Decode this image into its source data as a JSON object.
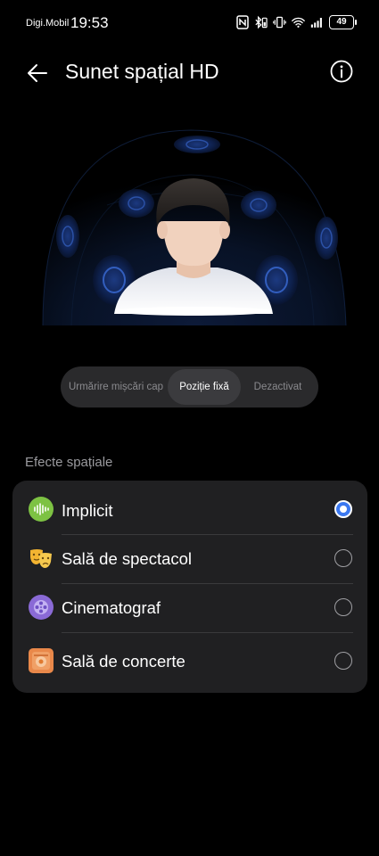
{
  "status": {
    "carrier": "Digi.Mobil",
    "time": "19:53",
    "battery": "49"
  },
  "header": {
    "title": "Sunet spațial HD"
  },
  "modes": {
    "items": [
      {
        "label": "Urmărire mișcări cap",
        "selected": false
      },
      {
        "label": "Poziție fixă",
        "selected": true
      },
      {
        "label": "Dezactivat",
        "selected": false
      }
    ]
  },
  "effects": {
    "section_title": "Efecte spațiale",
    "items": [
      {
        "label": "Implicit",
        "icon": "soundwave-icon",
        "color": "#7dc243",
        "selected": true
      },
      {
        "label": "Sală de spectacol",
        "icon": "theater-masks-icon",
        "color": "#f1b33a",
        "selected": false
      },
      {
        "label": "Cinematograf",
        "icon": "film-reel-icon",
        "color": "#8a6ad6",
        "selected": false
      },
      {
        "label": "Sală de concerte",
        "icon": "concert-hall-icon",
        "color": "#e9884a",
        "selected": false
      }
    ]
  },
  "colors": {
    "accent": "#3b78f0",
    "card": "#202022",
    "segment_bg": "#2a2a2c"
  }
}
